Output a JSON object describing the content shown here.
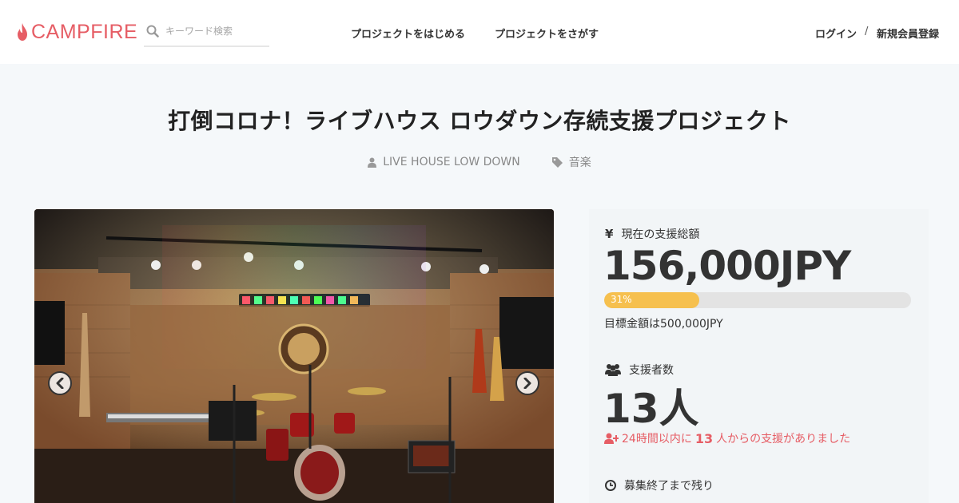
{
  "header": {
    "logo_text": "CAMPFIRE",
    "search_placeholder": "キーワード検索",
    "nav_start": "プロジェクトをはじめる",
    "nav_find": "プロジェクトをさがす",
    "login": "ログイン",
    "separator": "/",
    "signup": "新規会員登録"
  },
  "project": {
    "title": "打倒コロナ！ライブハウス ロウダウン存続支援プロジェクト",
    "owner": "LIVE HOUSE LOW DOWN",
    "category": "音楽"
  },
  "stats": {
    "total_label": "現在の支援総額",
    "total_amount": "156,000JPY",
    "progress_percent": 31,
    "progress_label": "31%",
    "goal_text": "目標金額は500,000JPY",
    "backers_label": "支援者数",
    "backers_count": "13人",
    "recent_prefix": "24時間以内に",
    "recent_count": "13",
    "recent_suffix": "人からの支援がありました",
    "remaining_label": "募集終了まで残り"
  },
  "colors": {
    "accent": "#e65d65",
    "progress": "#f6c04e",
    "text": "#333333"
  }
}
